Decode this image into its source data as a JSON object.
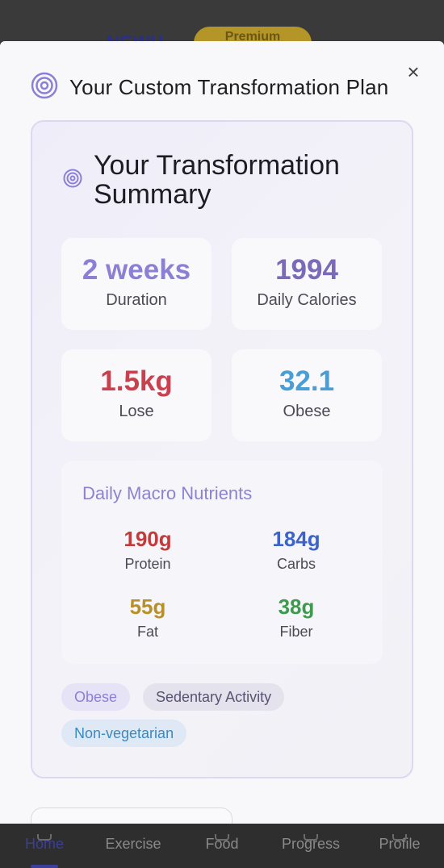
{
  "background": {
    "logo": "NEWU",
    "premium_label": "Premium",
    "nav": [
      {
        "label": "Home"
      },
      {
        "label": "Exercise"
      },
      {
        "label": "Food"
      },
      {
        "label": "Progress"
      },
      {
        "label": "Profile"
      }
    ]
  },
  "modal": {
    "title": "Your Custom Transformation Plan",
    "close_icon": "×",
    "summary": {
      "title": "Your Transformation Summary",
      "stats": [
        {
          "value": "2 weeks",
          "label": "Duration",
          "color": "#8b80d6"
        },
        {
          "value": "1994",
          "label": "Daily Calories",
          "color": "#7a6ab8"
        },
        {
          "value": "1.5kg",
          "label": "Lose",
          "color": "#c9404e"
        },
        {
          "value": "32.1",
          "label": "Obese",
          "color": "#4a9ed6"
        }
      ],
      "macros": {
        "title": "Daily Macro Nutrients",
        "items": [
          {
            "value": "190g",
            "label": "Protein",
            "color": "#c23b3b"
          },
          {
            "value": "184g",
            "label": "Carbs",
            "color": "#3b63c9"
          },
          {
            "value": "55g",
            "label": "Fat",
            "color": "#b8902a"
          },
          {
            "value": "38g",
            "label": "Fiber",
            "color": "#3e9a4e"
          }
        ]
      },
      "tags": [
        {
          "label": "Obese",
          "color": "#8b80d6",
          "bg": "#e6e3f6"
        },
        {
          "label": "Sedentary Activity",
          "color": "#5a5270",
          "bg": "#e4e2ec"
        },
        {
          "label": "Non-vegetarian",
          "color": "#3a8ac0",
          "bg": "#dfe9f5"
        }
      ]
    }
  },
  "colors": {
    "accent": "#8b80d6",
    "icon": "#8b80d6"
  }
}
